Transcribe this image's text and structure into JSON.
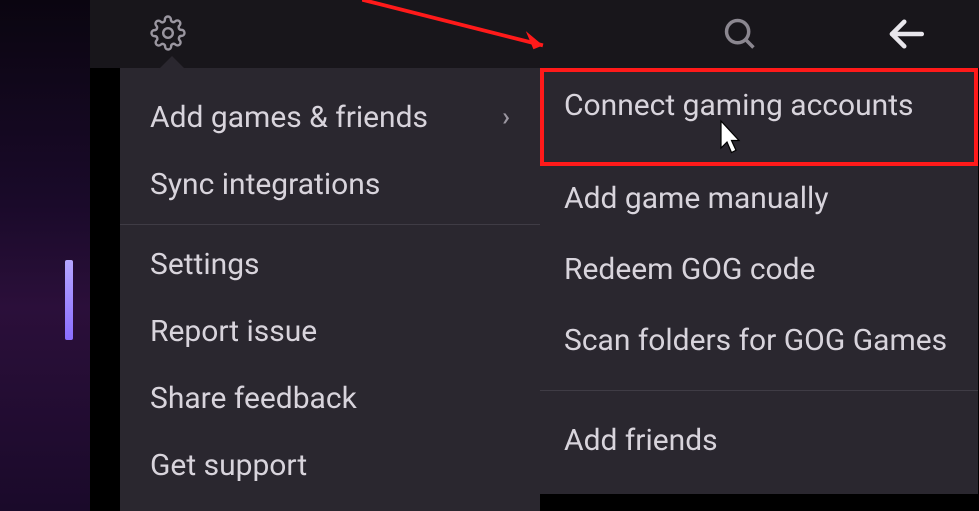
{
  "topbar": {
    "gear_icon": "gear",
    "search_icon": "search",
    "back_icon": "back"
  },
  "menu": {
    "items": [
      {
        "label": "Add games & friends",
        "has_submenu": true
      },
      {
        "label": "Sync integrations",
        "has_submenu": false
      }
    ],
    "items2": [
      {
        "label": "Settings"
      },
      {
        "label": "Report issue"
      },
      {
        "label": "Share feedback"
      },
      {
        "label": "Get support"
      }
    ]
  },
  "submenu": {
    "group1": [
      {
        "label": "Connect gaming accounts"
      },
      {
        "label": "Add game manually"
      },
      {
        "label": "Redeem GOG code"
      },
      {
        "label": "Scan folders for GOG Games"
      }
    ],
    "group2": [
      {
        "label": "Add friends"
      }
    ]
  },
  "annotation": {
    "highlight_color": "#ff1a1a"
  }
}
